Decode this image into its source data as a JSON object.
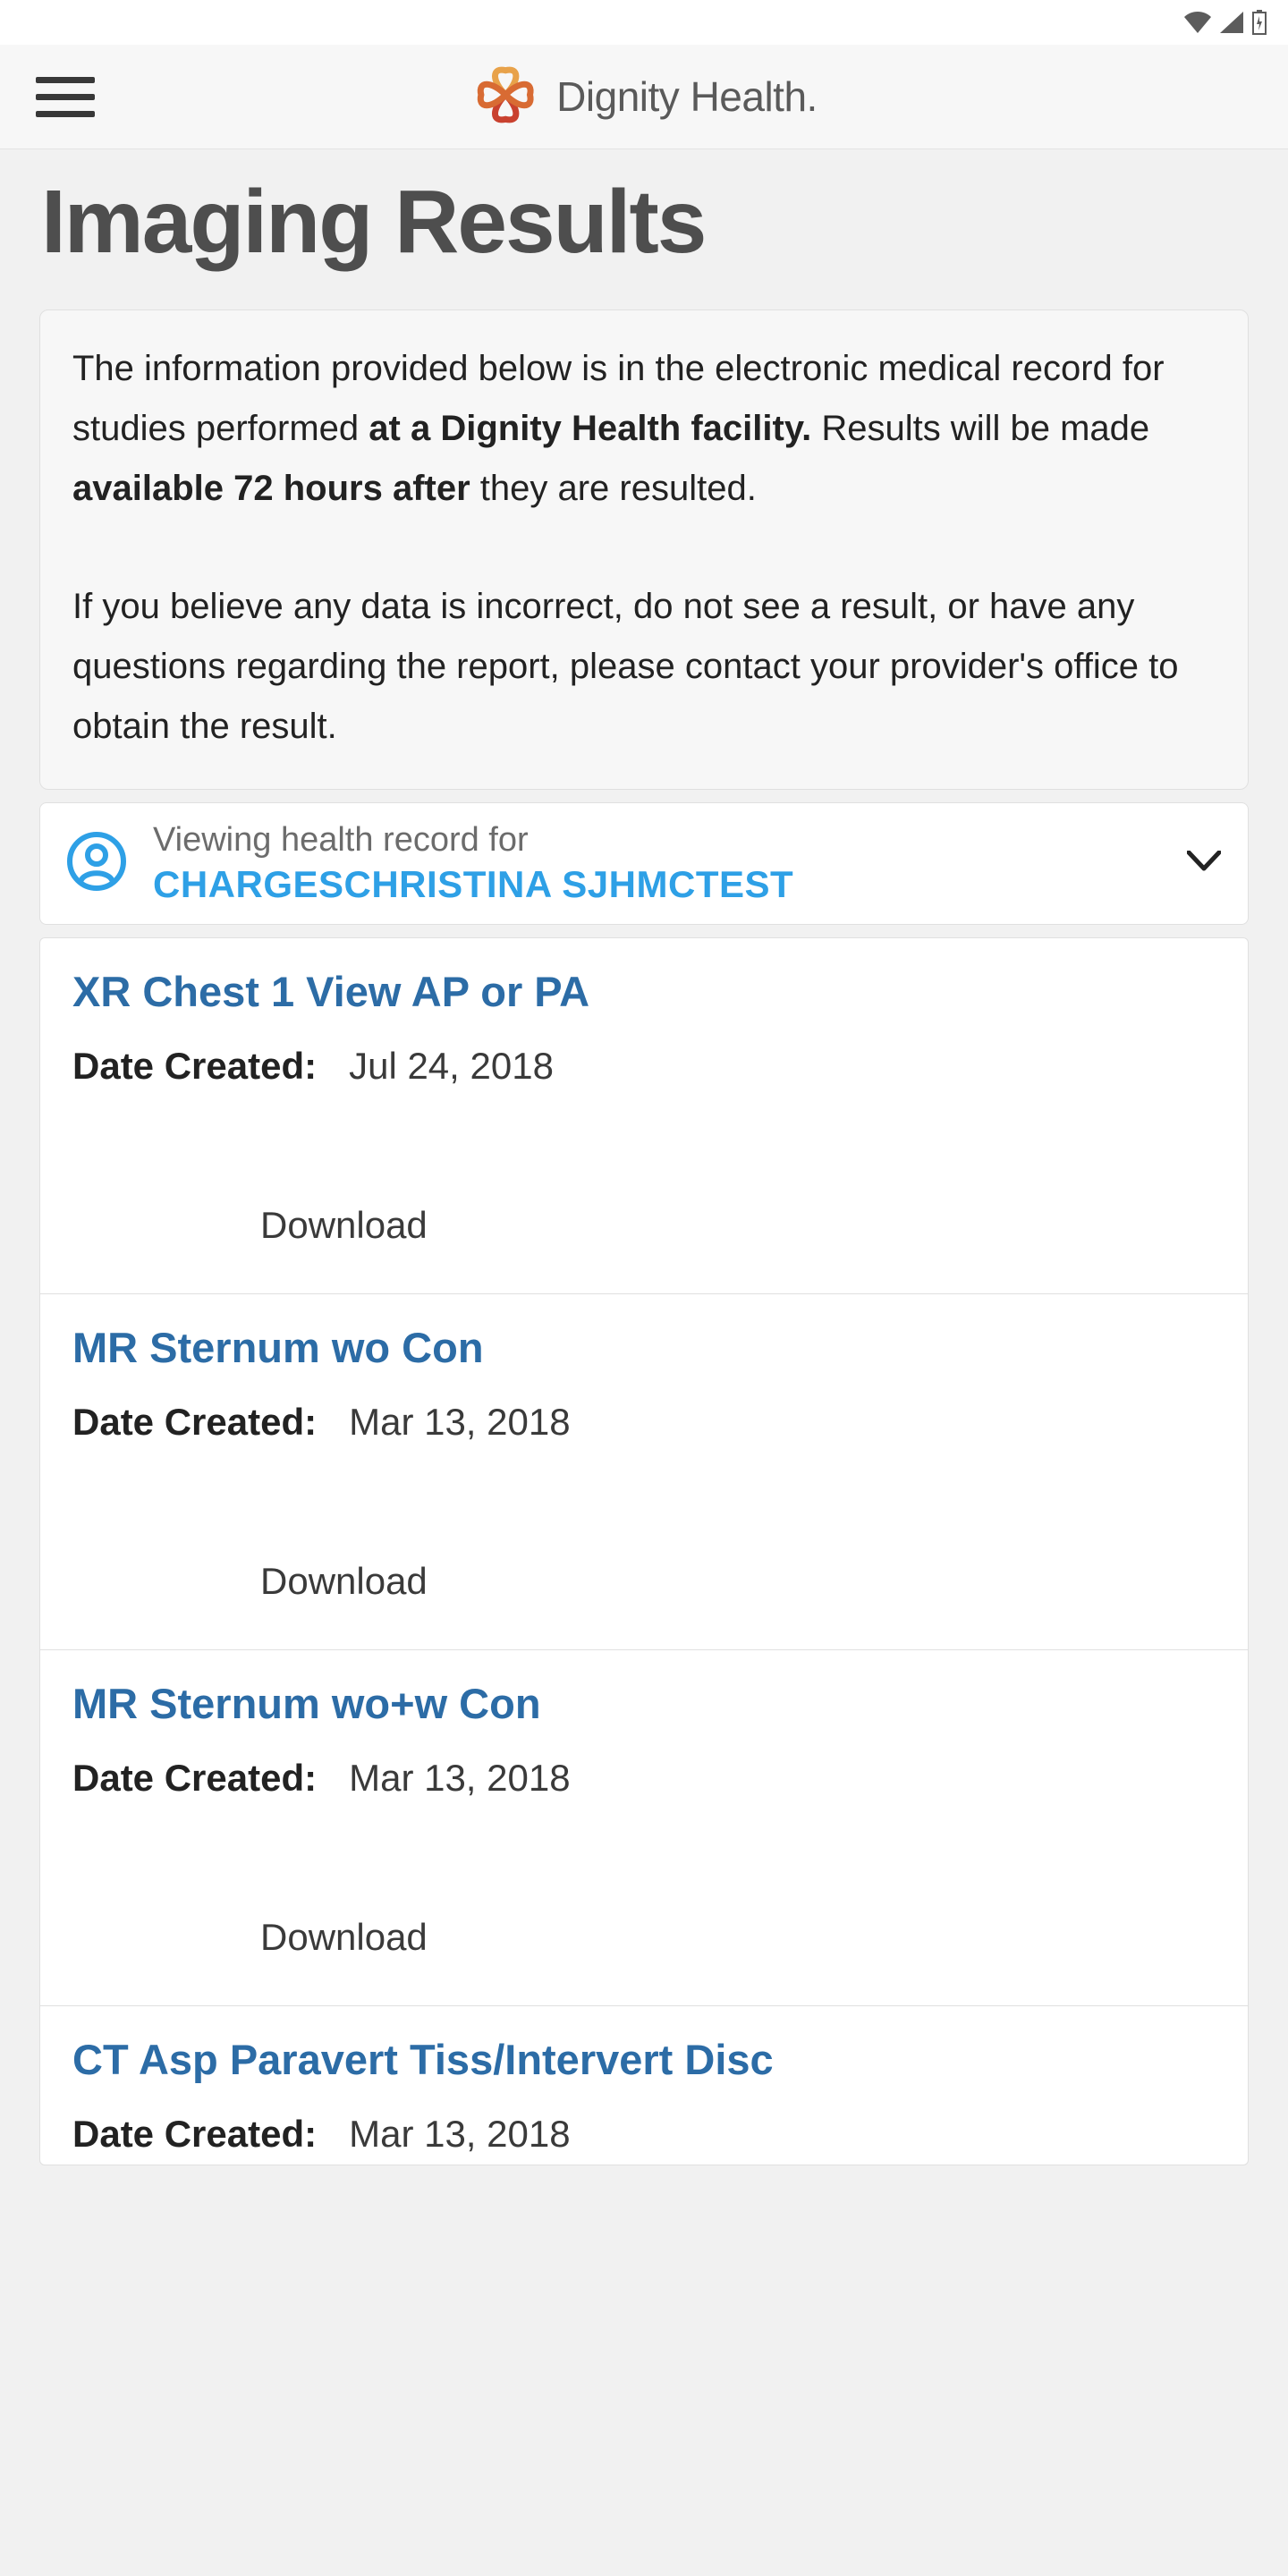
{
  "header": {
    "brand_text": "Dignity Health."
  },
  "page": {
    "title": "Imaging Results"
  },
  "info": {
    "p1_a": "The information provided below is in the electronic medical record for studies performed ",
    "p1_b": "at a Dignity Health facility.",
    "p1_c": " Results will be made ",
    "p1_d": "available 72 hours after",
    "p1_e": " they are resulted.",
    "p2": "If you believe any data is incorrect, do not see a result, or have any questions regarding the report, please contact your provider's office to obtain the result."
  },
  "record_selector": {
    "label": "Viewing health record for",
    "value": "CHARGESCHRISTINA SJHMCTEST"
  },
  "results": {
    "date_label": "Date Created:",
    "download_label": "Download",
    "items": [
      {
        "title": "XR Chest 1 View AP or PA",
        "date": "Jul 24, 2018"
      },
      {
        "title": "MR Sternum wo Con",
        "date": "Mar 13, 2018"
      },
      {
        "title": "MR Sternum wo+w Con",
        "date": "Mar 13, 2018"
      },
      {
        "title": "CT Asp Paravert Tiss/Intervert Disc",
        "date": "Mar 13, 2018"
      }
    ]
  },
  "colors": {
    "accent_blue": "#2ea0e6",
    "link_blue": "#2c6ca6",
    "brand_orange": "#e6822a"
  }
}
